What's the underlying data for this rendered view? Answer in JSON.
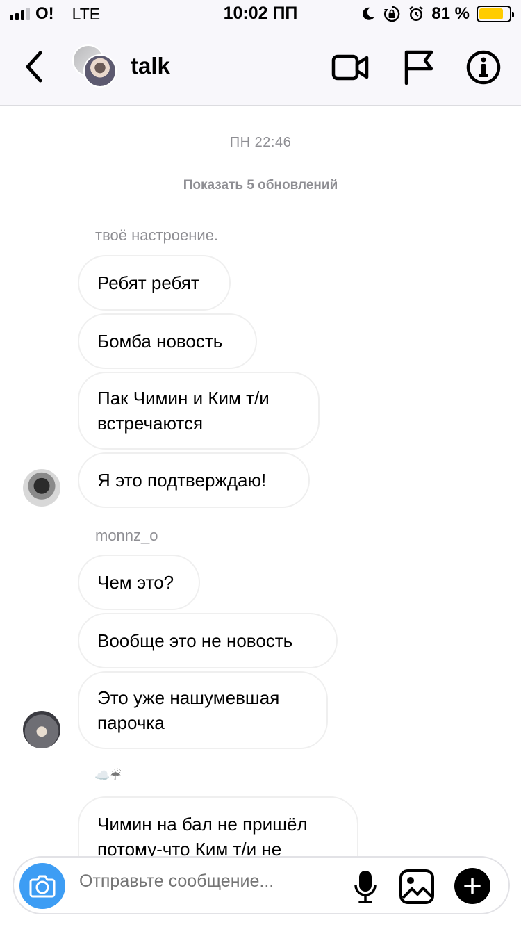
{
  "status_bar": {
    "carrier": "O!",
    "network": "LTE",
    "time": "10:02 ПП",
    "battery_percent": "81 %",
    "battery_level": 0.81,
    "battery_color": "#ffcc00"
  },
  "header": {
    "title": "talk",
    "icons": [
      "back-chevron-icon",
      "video-call-icon",
      "flag-icon",
      "info-icon"
    ]
  },
  "chat": {
    "timestamp": "ПН 22:46",
    "show_updates": "Показать 5 обновлений",
    "groups": [
      {
        "sender": "твоё настроение.",
        "messages": [
          "Ребят ребят",
          "Бомба новость",
          "Пак Чимин и Ким т/и встречаются",
          "Я это подтверждаю!"
        ]
      },
      {
        "sender": "monnz_o",
        "messages": [
          "Чем это?",
          "Вообще это не новость",
          "Это уже нашумевшая парочка"
        ]
      },
      {
        "sender": "☁️☔",
        "messages": [
          "Чимин на бал не пришёл потому-что Ким т/и не"
        ]
      }
    ]
  },
  "composer": {
    "placeholder": "Отправьте сообщение...",
    "accent_color": "#3d9df4",
    "icons": [
      "camera-icon",
      "microphone-icon",
      "gallery-icon",
      "plus-icon"
    ]
  }
}
